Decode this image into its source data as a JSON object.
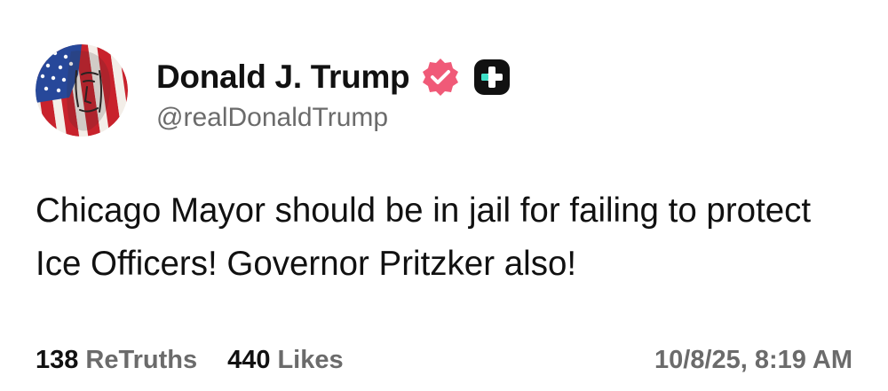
{
  "profile": {
    "display_name": "Donald J. Trump",
    "handle": "@realDonaldTrump",
    "avatar_icon": "avatar-flag-portrait",
    "verified_icon": "verified-badge-icon",
    "plus_icon": "plus-badge-icon"
  },
  "post": {
    "text": "Chicago Mayor should be in jail for failing to protect Ice Officers! Governor Pritzker also!"
  },
  "stats": {
    "retruths_count": "138",
    "retruths_label": "ReTruths",
    "likes_count": "440",
    "likes_label": "Likes"
  },
  "timestamp": "10/8/25, 8:19 AM",
  "colors": {
    "text_primary": "#111111",
    "text_secondary": "#6b6b6b",
    "verified_badge": "#f05a78",
    "plus_badge_bg": "#111111",
    "plus_badge_accent": "#3de0c8"
  }
}
